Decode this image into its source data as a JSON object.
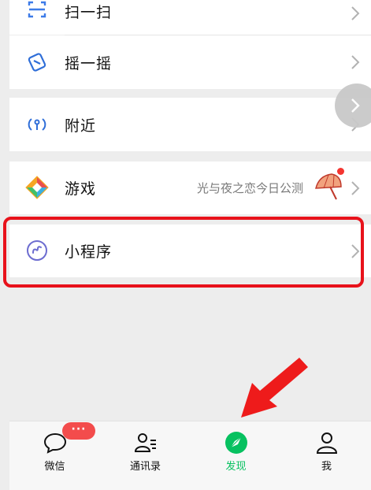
{
  "menu": {
    "items": [
      {
        "label": "扫一扫",
        "icon": "scan-icon"
      },
      {
        "label": "摇一摇",
        "icon": "shake-icon"
      },
      {
        "label": "附近",
        "icon": "nearby-icon"
      },
      {
        "label": "游戏",
        "icon": "game-icon",
        "subtitle": "光与夜之恋今日公测"
      },
      {
        "label": "小程序",
        "icon": "mini-program-icon"
      }
    ]
  },
  "tabbar": {
    "tabs": [
      {
        "label": "微信",
        "icon": "chat-icon",
        "badge": "···"
      },
      {
        "label": "通讯录",
        "icon": "contacts-icon"
      },
      {
        "label": "发现",
        "icon": "discover-icon",
        "active": true
      },
      {
        "label": "我",
        "icon": "me-icon"
      }
    ]
  },
  "colors": {
    "active_tab": "#07c160",
    "highlight": "#e8121b",
    "badge": "#f34c4c",
    "background": "#ededed"
  }
}
